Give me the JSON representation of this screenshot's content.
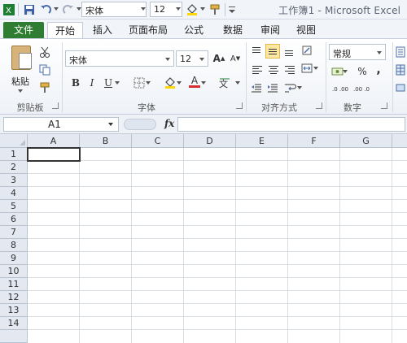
{
  "app": {
    "title": "工作簿1 - Microsoft Excel"
  },
  "quick_access": {
    "font_name": "宋体",
    "font_size": "12"
  },
  "tabs": [
    {
      "label": "文件"
    },
    {
      "label": "开始"
    },
    {
      "label": "插入"
    },
    {
      "label": "页面布局"
    },
    {
      "label": "公式"
    },
    {
      "label": "数据"
    },
    {
      "label": "审阅"
    },
    {
      "label": "视图"
    }
  ],
  "ribbon": {
    "clipboard": {
      "paste_label": "粘贴",
      "group_label": "剪贴板"
    },
    "font": {
      "font_name": "宋体",
      "font_size": "12",
      "group_label": "字体",
      "bold": "B",
      "italic": "I",
      "underline": "U",
      "color_a": "A"
    },
    "alignment": {
      "group_label": "对齐方式"
    },
    "number": {
      "format": "常规",
      "percent": "%",
      "comma": ",",
      "group_label": "数字",
      "inc_decimal": ".0 .00",
      "dec_decimal": ".00 .0"
    }
  },
  "formula_bar": {
    "name_box": "A1",
    "fx": "fx",
    "value": ""
  },
  "sheet": {
    "columns": [
      "A",
      "B",
      "C",
      "D",
      "E",
      "F",
      "G"
    ],
    "rows": [
      "1",
      "2",
      "3",
      "4",
      "5",
      "6",
      "7",
      "8",
      "9",
      "10",
      "11",
      "12",
      "13",
      "14"
    ],
    "selected_cell": "A1"
  },
  "colors": {
    "file_tab": "#2e7d32",
    "highlight": "#fde7a3",
    "font_color_red": "#d32f2f",
    "fill_yellow": "#ffd600"
  }
}
